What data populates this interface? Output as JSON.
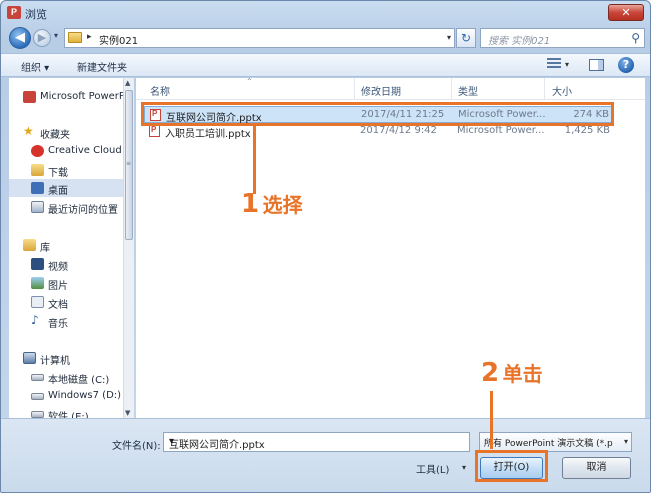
{
  "window": {
    "app_logo": "P",
    "title": "浏览",
    "close_icon": "✕"
  },
  "address_bar": {
    "path": "实例021",
    "refresh_icon": "refresh-icon",
    "search_placeholder": "搜索 实例021"
  },
  "toolbar": {
    "organize_label": "组织 ▾",
    "new_folder_label": "新建文件夹"
  },
  "nav_pane": {
    "items": [
      {
        "label": "Microsoft PowerPoint",
        "icon": "powerpoint-icon"
      },
      {
        "label": "收藏夹",
        "icon": "star-icon"
      },
      {
        "label": "Creative Cloud Files",
        "icon": "creative-cloud-icon"
      },
      {
        "label": "下载",
        "icon": "download-folder-icon"
      },
      {
        "label": "桌面",
        "icon": "desktop-icon"
      },
      {
        "label": "最近访问的位置",
        "icon": "recent-places-icon"
      },
      {
        "label": "库",
        "icon": "library-icon"
      },
      {
        "label": "视频",
        "icon": "video-icon"
      },
      {
        "label": "图片",
        "icon": "picture-icon"
      },
      {
        "label": "文档",
        "icon": "document-icon"
      },
      {
        "label": "音乐",
        "icon": "music-icon"
      },
      {
        "label": "计算机",
        "icon": "computer-icon"
      },
      {
        "label": "本地磁盘 (C:)",
        "icon": "drive-icon"
      },
      {
        "label": "Windows7 (D:)",
        "icon": "drive-icon"
      },
      {
        "label": "软件 (E:)",
        "icon": "drive-icon"
      }
    ],
    "selected_index": 4
  },
  "file_list": {
    "columns": [
      "名称",
      "修改日期",
      "类型",
      "大小"
    ],
    "rows": [
      {
        "name": "互联网公司简介.pptx",
        "modified": "2017/4/11 21:25",
        "type": "Microsoft Power...",
        "size": "274 KB",
        "selected": true
      },
      {
        "name": "入职员工培训.pptx",
        "modified": "2017/4/12 9:42",
        "type": "Microsoft Power...",
        "size": "1,425 KB",
        "selected": false
      }
    ]
  },
  "bottom": {
    "filename_label": "文件名(N):",
    "filename_value": "互联网公司简介.pptx",
    "filter_value": "所有 PowerPoint 演示文稿 (*.p",
    "tools_label": "工具(L)",
    "open_label": "打开(O)",
    "cancel_label": "取消"
  },
  "annotations": {
    "step1_number": "1",
    "step1_text": "选择",
    "step2_number": "2",
    "step2_text": "单击",
    "color": "#e8742a"
  }
}
